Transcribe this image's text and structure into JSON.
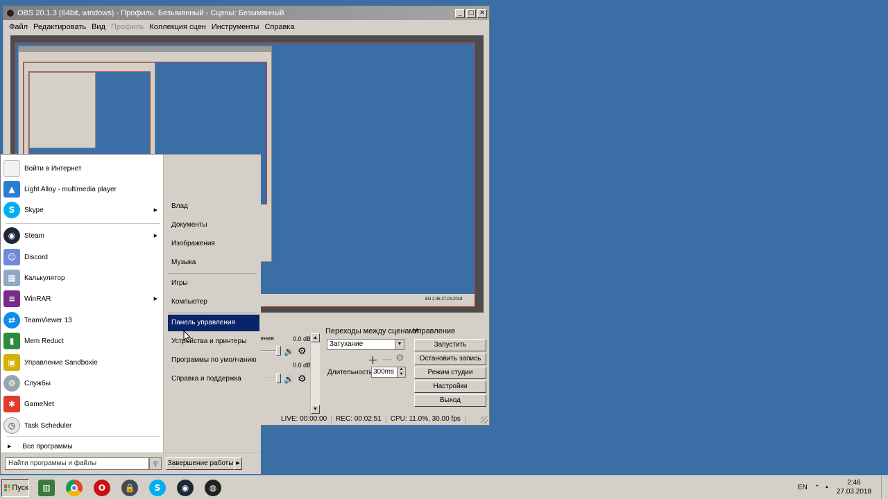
{
  "obs": {
    "title": "OBS 20.1.3 (64bit, windows) - Профиль: Безымянный - Сцены: Безымянный",
    "menu": [
      "Файл",
      "Редактировать",
      "Вид",
      "Профиль",
      "Коллекция сцен",
      "Инструменты",
      "Справка"
    ],
    "preview": {
      "tray_lang": "EN",
      "tray_time": "2:46",
      "tray_date": "27.03.2018"
    },
    "mixer": {
      "partial_label": "ения",
      "db1": "0.0 dB",
      "db2": "0.0 dB"
    },
    "transitions": {
      "header": "Переходы между сценами",
      "selected": "Затухание",
      "duration_label": "Длительность",
      "duration_value": "300ms"
    },
    "controls": {
      "header": "Управление",
      "buttons": [
        "Запустить трансляцию",
        "Остановить запись",
        "Режим студии",
        "Настройки",
        "Выход"
      ]
    },
    "status": {
      "live": "LIVE: 00:00:00",
      "rec": "REC: 00:02:51",
      "cpu": "CPU: 11.0%, 30.00 fps"
    }
  },
  "start_menu": {
    "programs": [
      {
        "label": "Войти в Интернет",
        "icon": "document-icon",
        "color": "#e8e8e8"
      },
      {
        "label": "Light Alloy - multimedia player",
        "icon": "light-alloy-icon",
        "color": "#2a7dd1"
      },
      {
        "label": "Skype",
        "icon": "skype-icon",
        "color": "#00aff0"
      },
      {
        "label": "Steam",
        "icon": "steam-icon",
        "color": "#1b2838"
      },
      {
        "label": "Discord",
        "icon": "discord-icon",
        "color": "#7289da"
      },
      {
        "label": "Калькулятор",
        "icon": "calculator-icon",
        "color": "#8fa9c4"
      },
      {
        "label": "WinRAR",
        "icon": "winrar-icon",
        "color": "#7a2a8a"
      },
      {
        "label": "TeamViewer 13",
        "icon": "teamviewer-icon",
        "color": "#0e8ee9"
      },
      {
        "label": "Mem Reduct",
        "icon": "mem-reduct-icon",
        "color": "#2e8b3e"
      },
      {
        "label": "Управление Sandboxie",
        "icon": "sandboxie-icon",
        "color": "#d4b000"
      },
      {
        "label": "Службы",
        "icon": "services-icon",
        "color": "#9aa4ae"
      },
      {
        "label": "GameNet",
        "icon": "gamenet-icon",
        "color": "#e03b2c"
      },
      {
        "label": "Task Scheduler",
        "icon": "task-scheduler-icon",
        "color": "#c9c9c9"
      }
    ],
    "all_programs": "Все программы",
    "right_items": [
      "Влад",
      "Документы",
      "Изображения",
      "Музыка",
      "Игры",
      "Компьютер",
      "Панель управления",
      "Устройства и принтеры",
      "Программы по умолчанию",
      "Справка и поддержка"
    ],
    "selected_right": "Панель управления",
    "search_placeholder": "Найти программы и файлы",
    "shutdown": "Завершение работы"
  },
  "taskbar": {
    "start_label": "Пуск",
    "apps": [
      {
        "name": "task-manager-icon",
        "color": "#3c7a3c"
      },
      {
        "name": "chrome-icon",
        "color": "#db4437"
      },
      {
        "name": "opera-icon",
        "color": "#cc0f16"
      },
      {
        "name": "lock-icon",
        "color": "#444a55"
      },
      {
        "name": "skype-icon",
        "color": "#00aff0"
      },
      {
        "name": "steam-icon",
        "color": "#1b2838"
      },
      {
        "name": "obs-icon",
        "color": "#222222"
      }
    ],
    "lang": "EN",
    "time": "2:46",
    "date": "27.03.2018"
  }
}
